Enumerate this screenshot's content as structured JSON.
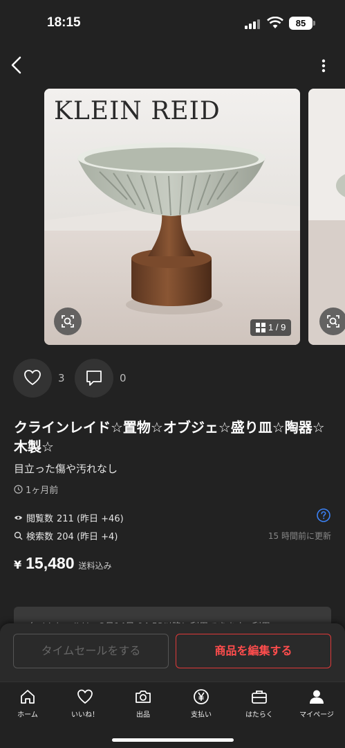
{
  "status_bar": {
    "time": "18:15",
    "battery": "85"
  },
  "product": {
    "brand_watermark": "KLEIN REID",
    "image_counter": "1 / 9",
    "likes": "3",
    "comments": "0",
    "title": "クラインレイド☆置物☆オブジェ☆盛り皿☆陶器☆木製☆",
    "condition": "目立った傷や汚れなし",
    "posted": "1ヶ月前",
    "views_label": "閲覧数",
    "views_value": "211 (昨日 +46)",
    "search_label": "検索数",
    "search_value": "204 (昨日 +4)",
    "updated": "15 時間前に更新",
    "price_symbol": "¥",
    "price": "15,480",
    "shipping": "送料込み"
  },
  "notice": {
    "text": "タイムセールは、2月14日 04:53以降に利用できます。利用"
  },
  "actions": {
    "time_sale": "タイムセールをする",
    "edit": "商品を編集する"
  },
  "tabs": [
    {
      "label": "ホーム",
      "icon": "home-icon"
    },
    {
      "label": "いいね！",
      "icon": "heart-icon"
    },
    {
      "label": "出品",
      "icon": "camera-icon"
    },
    {
      "label": "支払い",
      "icon": "yen-icon"
    },
    {
      "label": "はたらく",
      "icon": "briefcase-icon"
    },
    {
      "label": "マイページ",
      "icon": "person-icon"
    }
  ],
  "colors": {
    "background": "#222222",
    "accent": "#ff4d4d",
    "info": "#3b82f6"
  }
}
